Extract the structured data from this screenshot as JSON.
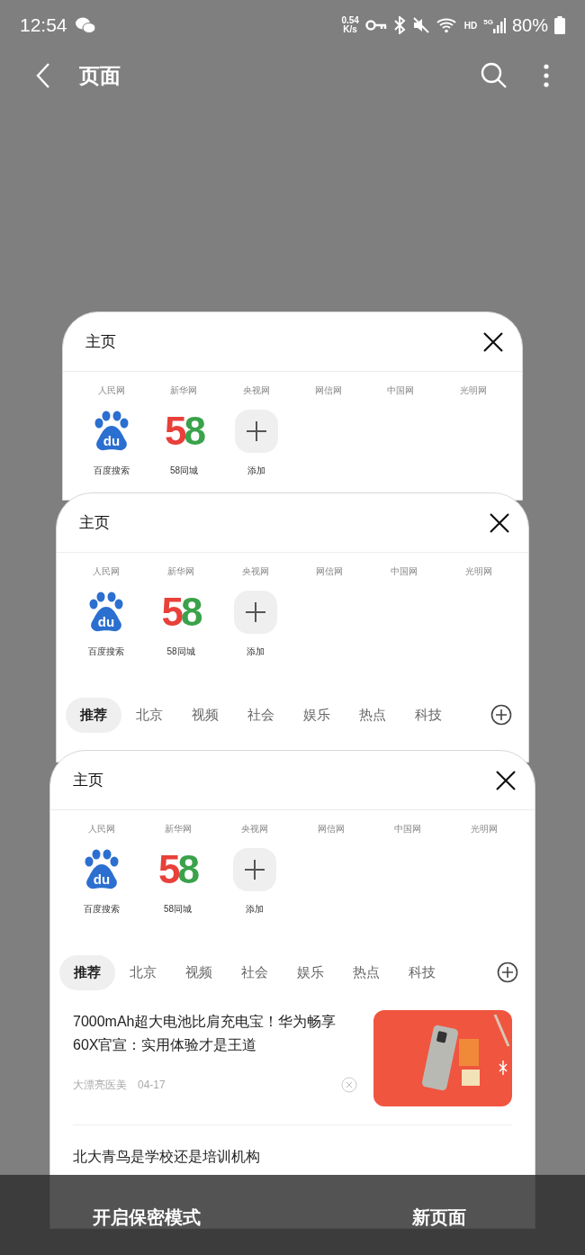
{
  "status_bar": {
    "time": "12:54",
    "net_speed": "0.54",
    "net_unit": "K/s",
    "hd": "HD",
    "network": "5G",
    "battery": "80%"
  },
  "header": {
    "title": "页面"
  },
  "tabs": [
    {
      "title": "主页",
      "quick_links": [
        "人民网",
        "新华网",
        "央视网",
        "网信网",
        "中国网",
        "光明网"
      ],
      "shortcuts": [
        {
          "kind": "paw",
          "label": "百度搜索",
          "logo_text": "du"
        },
        {
          "kind": "digits",
          "label": "58同城",
          "logo_text": "58"
        },
        {
          "kind": "add",
          "label": "添加"
        }
      ]
    },
    {
      "title": "主页",
      "quick_links": [
        "人民网",
        "新华网",
        "央视网",
        "网信网",
        "中国网",
        "光明网"
      ],
      "shortcuts": [
        {
          "kind": "paw",
          "label": "百度搜索",
          "logo_text": "du"
        },
        {
          "kind": "digits",
          "label": "58同城",
          "logo_text": "58"
        },
        {
          "kind": "add",
          "label": "添加"
        }
      ],
      "categories": [
        {
          "label": "推荐",
          "selected": true
        },
        {
          "label": "北京",
          "selected": false
        },
        {
          "label": "视频",
          "selected": false
        },
        {
          "label": "社会",
          "selected": false
        },
        {
          "label": "娱乐",
          "selected": false
        },
        {
          "label": "热点",
          "selected": false
        },
        {
          "label": "科技",
          "selected": false
        }
      ]
    },
    {
      "title": "主页",
      "quick_links": [
        "人民网",
        "新华网",
        "央视网",
        "网信网",
        "中国网",
        "光明网"
      ],
      "shortcuts": [
        {
          "kind": "paw",
          "label": "百度搜索",
          "logo_text": "du"
        },
        {
          "kind": "digits",
          "label": "58同城",
          "logo_text": "58"
        },
        {
          "kind": "add",
          "label": "添加"
        }
      ],
      "categories": [
        {
          "label": "推荐",
          "selected": true
        },
        {
          "label": "北京",
          "selected": false
        },
        {
          "label": "视频",
          "selected": false
        },
        {
          "label": "社会",
          "selected": false
        },
        {
          "label": "娱乐",
          "selected": false
        },
        {
          "label": "热点",
          "selected": false
        },
        {
          "label": "科技",
          "selected": false
        }
      ],
      "news": [
        {
          "title": "7000mAh超大电池比肩充电宝！华为畅享60X官宣：实用体验才是王道",
          "source": "大漂亮医美",
          "date": "04-17",
          "kind": "picture"
        },
        {
          "title": "北大青鸟是学校还是培训机构"
        }
      ]
    }
  ],
  "bottom_bar": [
    "开启保密模式",
    "新页面"
  ]
}
